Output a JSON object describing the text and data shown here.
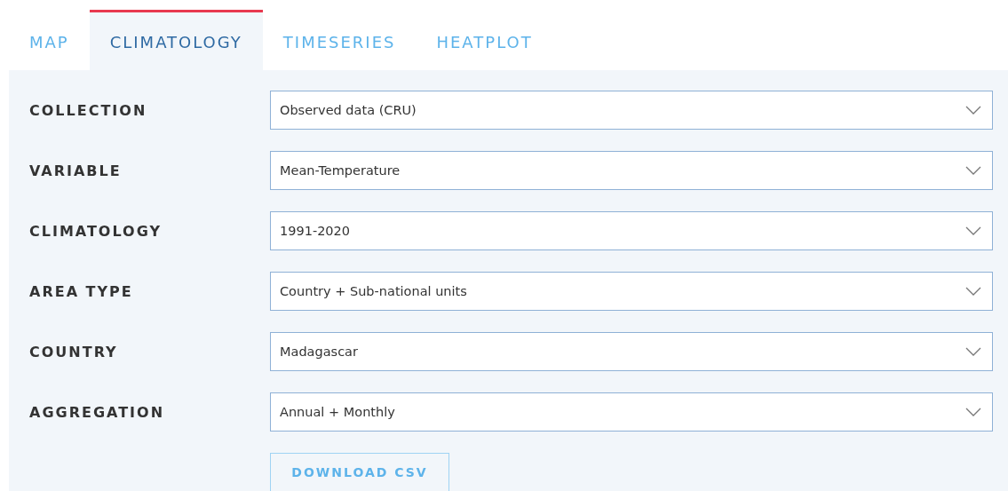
{
  "tabs": [
    {
      "label": "MAP",
      "selected": false
    },
    {
      "label": "CLIMATOLOGY",
      "selected": true
    },
    {
      "label": "TIMESERIES",
      "selected": false
    },
    {
      "label": "HEATPLOT",
      "selected": false
    }
  ],
  "fields": [
    {
      "label": "COLLECTION",
      "value": "Observed data (CRU)"
    },
    {
      "label": "VARIABLE",
      "value": "Mean-Temperature"
    },
    {
      "label": "CLIMATOLOGY",
      "value": "1991-2020"
    },
    {
      "label": "AREA TYPE",
      "value": "Country + Sub-national units"
    },
    {
      "label": "COUNTRY",
      "value": "Madagascar"
    },
    {
      "label": "AGGREGATION",
      "value": "Annual + Monthly"
    }
  ],
  "download_button": "DOWNLOAD CSV"
}
